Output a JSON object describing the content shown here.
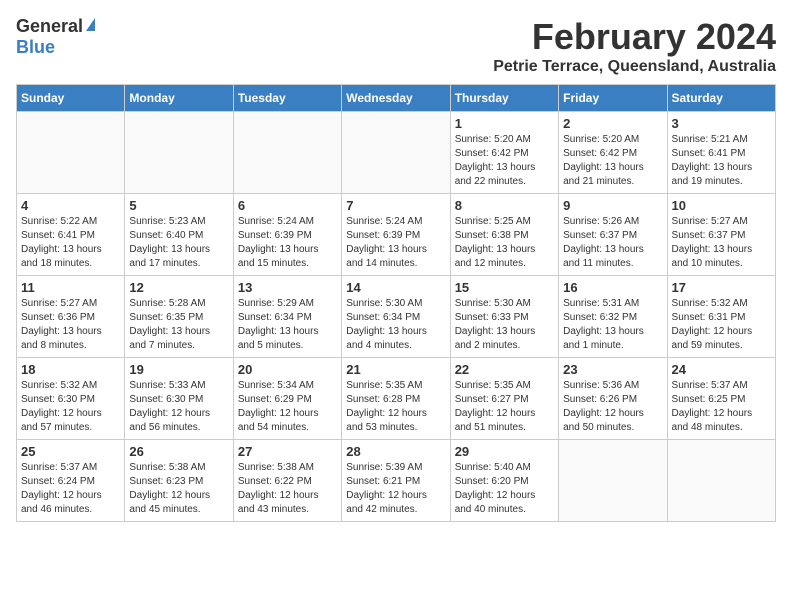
{
  "header": {
    "logo_general": "General",
    "logo_blue": "Blue",
    "month_title": "February 2024",
    "location": "Petrie Terrace, Queensland, Australia"
  },
  "weekdays": [
    "Sunday",
    "Monday",
    "Tuesday",
    "Wednesday",
    "Thursday",
    "Friday",
    "Saturday"
  ],
  "weeks": [
    [
      {
        "day": "",
        "info": ""
      },
      {
        "day": "",
        "info": ""
      },
      {
        "day": "",
        "info": ""
      },
      {
        "day": "",
        "info": ""
      },
      {
        "day": "1",
        "info": "Sunrise: 5:20 AM\nSunset: 6:42 PM\nDaylight: 13 hours\nand 22 minutes."
      },
      {
        "day": "2",
        "info": "Sunrise: 5:20 AM\nSunset: 6:42 PM\nDaylight: 13 hours\nand 21 minutes."
      },
      {
        "day": "3",
        "info": "Sunrise: 5:21 AM\nSunset: 6:41 PM\nDaylight: 13 hours\nand 19 minutes."
      }
    ],
    [
      {
        "day": "4",
        "info": "Sunrise: 5:22 AM\nSunset: 6:41 PM\nDaylight: 13 hours\nand 18 minutes."
      },
      {
        "day": "5",
        "info": "Sunrise: 5:23 AM\nSunset: 6:40 PM\nDaylight: 13 hours\nand 17 minutes."
      },
      {
        "day": "6",
        "info": "Sunrise: 5:24 AM\nSunset: 6:39 PM\nDaylight: 13 hours\nand 15 minutes."
      },
      {
        "day": "7",
        "info": "Sunrise: 5:24 AM\nSunset: 6:39 PM\nDaylight: 13 hours\nand 14 minutes."
      },
      {
        "day": "8",
        "info": "Sunrise: 5:25 AM\nSunset: 6:38 PM\nDaylight: 13 hours\nand 12 minutes."
      },
      {
        "day": "9",
        "info": "Sunrise: 5:26 AM\nSunset: 6:37 PM\nDaylight: 13 hours\nand 11 minutes."
      },
      {
        "day": "10",
        "info": "Sunrise: 5:27 AM\nSunset: 6:37 PM\nDaylight: 13 hours\nand 10 minutes."
      }
    ],
    [
      {
        "day": "11",
        "info": "Sunrise: 5:27 AM\nSunset: 6:36 PM\nDaylight: 13 hours\nand 8 minutes."
      },
      {
        "day": "12",
        "info": "Sunrise: 5:28 AM\nSunset: 6:35 PM\nDaylight: 13 hours\nand 7 minutes."
      },
      {
        "day": "13",
        "info": "Sunrise: 5:29 AM\nSunset: 6:34 PM\nDaylight: 13 hours\nand 5 minutes."
      },
      {
        "day": "14",
        "info": "Sunrise: 5:30 AM\nSunset: 6:34 PM\nDaylight: 13 hours\nand 4 minutes."
      },
      {
        "day": "15",
        "info": "Sunrise: 5:30 AM\nSunset: 6:33 PM\nDaylight: 13 hours\nand 2 minutes."
      },
      {
        "day": "16",
        "info": "Sunrise: 5:31 AM\nSunset: 6:32 PM\nDaylight: 13 hours\nand 1 minute."
      },
      {
        "day": "17",
        "info": "Sunrise: 5:32 AM\nSunset: 6:31 PM\nDaylight: 12 hours\nand 59 minutes."
      }
    ],
    [
      {
        "day": "18",
        "info": "Sunrise: 5:32 AM\nSunset: 6:30 PM\nDaylight: 12 hours\nand 57 minutes."
      },
      {
        "day": "19",
        "info": "Sunrise: 5:33 AM\nSunset: 6:30 PM\nDaylight: 12 hours\nand 56 minutes."
      },
      {
        "day": "20",
        "info": "Sunrise: 5:34 AM\nSunset: 6:29 PM\nDaylight: 12 hours\nand 54 minutes."
      },
      {
        "day": "21",
        "info": "Sunrise: 5:35 AM\nSunset: 6:28 PM\nDaylight: 12 hours\nand 53 minutes."
      },
      {
        "day": "22",
        "info": "Sunrise: 5:35 AM\nSunset: 6:27 PM\nDaylight: 12 hours\nand 51 minutes."
      },
      {
        "day": "23",
        "info": "Sunrise: 5:36 AM\nSunset: 6:26 PM\nDaylight: 12 hours\nand 50 minutes."
      },
      {
        "day": "24",
        "info": "Sunrise: 5:37 AM\nSunset: 6:25 PM\nDaylight: 12 hours\nand 48 minutes."
      }
    ],
    [
      {
        "day": "25",
        "info": "Sunrise: 5:37 AM\nSunset: 6:24 PM\nDaylight: 12 hours\nand 46 minutes."
      },
      {
        "day": "26",
        "info": "Sunrise: 5:38 AM\nSunset: 6:23 PM\nDaylight: 12 hours\nand 45 minutes."
      },
      {
        "day": "27",
        "info": "Sunrise: 5:38 AM\nSunset: 6:22 PM\nDaylight: 12 hours\nand 43 minutes."
      },
      {
        "day": "28",
        "info": "Sunrise: 5:39 AM\nSunset: 6:21 PM\nDaylight: 12 hours\nand 42 minutes."
      },
      {
        "day": "29",
        "info": "Sunrise: 5:40 AM\nSunset: 6:20 PM\nDaylight: 12 hours\nand 40 minutes."
      },
      {
        "day": "",
        "info": ""
      },
      {
        "day": "",
        "info": ""
      }
    ]
  ]
}
